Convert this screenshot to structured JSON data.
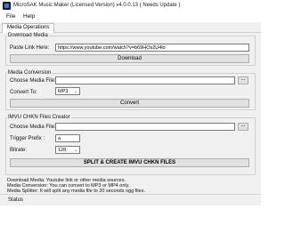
{
  "window": {
    "title": "MicroSAK Music Maker (Licensed Version) v4.0.0.13 ( Needs Update )"
  },
  "menu": {
    "file": "File",
    "help": "Help"
  },
  "tabs": {
    "media_operations": "Media Operations"
  },
  "download": {
    "group_title": "Download Media",
    "paste_label": "Paste Link Here:",
    "link_value": "https://www.youtube.com/watch?v=b69HOs2U4lo",
    "button": "Download"
  },
  "conversion": {
    "group_title": "Media Conversion",
    "choose_label": "Choose Media File:",
    "file_value": "",
    "browse": "...",
    "convert_to_label": "Convert To:",
    "format_value": "MP3",
    "button": "Convert"
  },
  "chkn": {
    "group_title": "IMVU CHKN Files Creator",
    "choose_label": "Choose Media File:",
    "file_value": "",
    "browse": "...",
    "trigger_label": "Trigger Prefix :",
    "trigger_value": "a",
    "bitrate_label": "Bitrate:",
    "bitrate_value": "128",
    "button": "SPLIT & CREATE IMVU CHKN FILES"
  },
  "info": {
    "line1": "Download Media: Youtube link or other media sources.",
    "line2": "Media Conversion: You can convert to MP3 or MP4 only.",
    "line3": "Media Splitter: It will split any media file to 20 seconds ogg files."
  },
  "status": {
    "text": "Status"
  }
}
